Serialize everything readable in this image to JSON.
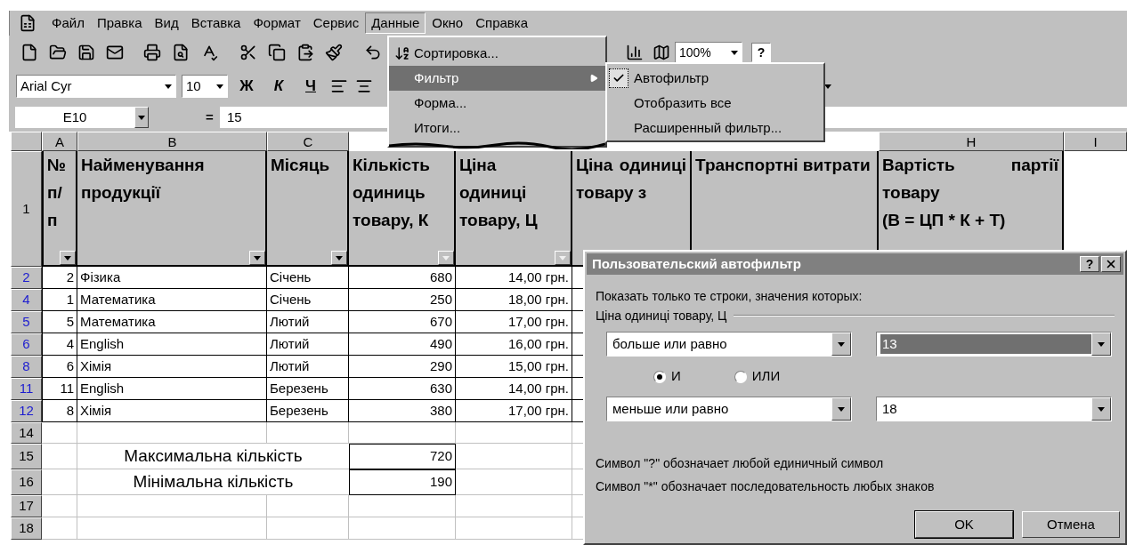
{
  "menu_bar": {
    "items": [
      {
        "label": "Файл",
        "selected": false
      },
      {
        "label": "Правка",
        "selected": false
      },
      {
        "label": "Вид",
        "selected": false
      },
      {
        "label": "Вставка",
        "selected": false
      },
      {
        "label": "Формат",
        "selected": false
      },
      {
        "label": "Сервис",
        "selected": false
      },
      {
        "label": "Данные",
        "selected": true
      },
      {
        "label": "Окно",
        "selected": false
      },
      {
        "label": "Справка",
        "selected": false
      }
    ]
  },
  "standard_toolbar": {
    "zoom": "100%",
    "help": "?"
  },
  "formatting_toolbar": {
    "font": "Arial Cyr",
    "size": "10",
    "bold": "Ж",
    "italic": "К",
    "underline": "Ч"
  },
  "formula_bar": {
    "cell_name": "E10",
    "equals": "=",
    "value": "15"
  },
  "sheet": {
    "column_headers_left": [
      "A",
      "B",
      "C"
    ],
    "column_headers_right": [
      "H",
      "I"
    ],
    "header_row": {
      "row": "1",
      "cells": [
        {
          "text": "№ п/ п",
          "filter_active": false
        },
        {
          "text": "Найменування продукції",
          "filter_active": false
        },
        {
          "text": "Місяць",
          "filter_active": false
        },
        {
          "text": "Кількість одиниць товару, К",
          "filter_active": true
        },
        {
          "text": "Ціна одиниці товару, Ц",
          "filter_active": true
        },
        {
          "text": "Ціна одиниці товару з"
        },
        {
          "text": "Транспортні витрати"
        },
        {
          "text": "Вартість партії товару\n(В = ЦП * К + Т)"
        }
      ]
    },
    "rows": [
      {
        "row": "2",
        "filtered": true,
        "cells": [
          "2",
          "Фізика",
          "Січень",
          "680",
          "14,00 грн."
        ]
      },
      {
        "row": "4",
        "filtered": true,
        "cells": [
          "1",
          "Математика",
          "Січень",
          "250",
          "18,00 грн."
        ]
      },
      {
        "row": "5",
        "filtered": true,
        "cells": [
          "5",
          "Математика",
          "Лютий",
          "670",
          "17,00 грн."
        ]
      },
      {
        "row": "6",
        "filtered": true,
        "cells": [
          "4",
          "English",
          "Лютий",
          "490",
          "16,00 грн."
        ]
      },
      {
        "row": "8",
        "filtered": true,
        "cells": [
          "6",
          "Хімія",
          "Лютий",
          "290",
          "15,00 грн."
        ]
      },
      {
        "row": "11",
        "filtered": true,
        "cells": [
          "11",
          "English",
          "Березень",
          "630",
          "14,00 грн."
        ]
      },
      {
        "row": "12",
        "filtered": true,
        "cells": [
          "8",
          "Хімія",
          "Березень",
          "380",
          "17,00 грн."
        ]
      }
    ],
    "rows_below": [
      {
        "row": "14",
        "kind": "empty",
        "filtered": false
      },
      {
        "row": "15",
        "kind": "summary",
        "filtered": false,
        "label": "Максимальна кількість",
        "value": "720"
      },
      {
        "row": "16",
        "kind": "summary",
        "filtered": false,
        "label": "Мінімальна кількість",
        "value": "190"
      },
      {
        "row": "17",
        "kind": "empty",
        "filtered": false
      },
      {
        "row": "18",
        "kind": "empty",
        "filtered": false
      }
    ]
  },
  "data_menu": {
    "items": [
      {
        "label": "Сортировка...",
        "kind": "sort",
        "selected": false
      },
      {
        "label": "Фильтр",
        "kind": "submenu",
        "selected": true
      },
      {
        "label": "Форма...",
        "kind": "plain",
        "selected": false
      },
      {
        "label": "Итоги...",
        "kind": "plain",
        "selected": false
      }
    ]
  },
  "filter_submenu": {
    "items": [
      {
        "label": "Автофильтр",
        "checked": true
      },
      {
        "label": "Отобразить все",
        "checked": false
      },
      {
        "label": "Расширенный фильтр...",
        "checked": false
      }
    ]
  },
  "dialog": {
    "title": "Пользовательский автофильтр",
    "help": "?",
    "prompt": "Показать только те строки, значения которых:",
    "field": "Ціна одиниці товару, Ц",
    "conditions": [
      {
        "operator": "больше или равно",
        "value": "13",
        "value_selected": true
      },
      {
        "operator": "меньше или равно",
        "value": "18",
        "value_selected": false
      }
    ],
    "logic": [
      {
        "label": "И",
        "selected": true
      },
      {
        "label": "ИЛИ",
        "selected": false
      }
    ],
    "hints": [
      "Символ \"?\" обозначает любой единичный символ",
      "Символ \"*\" обозначает последовательность любых знаков"
    ],
    "buttons": [
      "OK",
      "Отмена"
    ]
  }
}
